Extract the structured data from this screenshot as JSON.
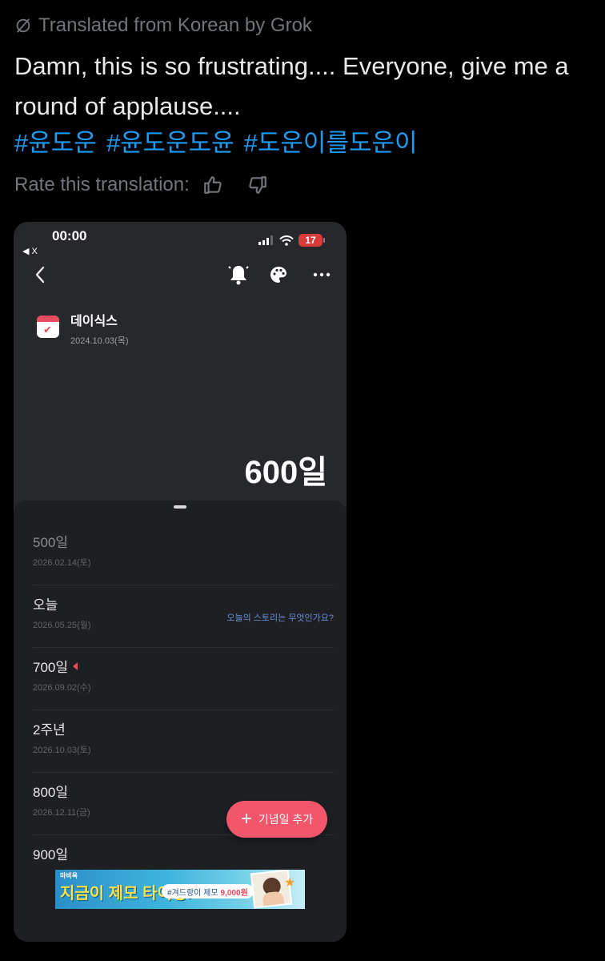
{
  "tweet": {
    "translated_label": "Translated from Korean by Grok",
    "text": "Damn, this is so frustrating.... Everyone, give me a round of applause....",
    "hashtags": [
      "#윤도운",
      "#윤도운도윤",
      "#도운이를도운이"
    ],
    "rate_label": "Rate this translation:",
    "icons": [
      "grok-slash-icon",
      "thumbs-up-icon",
      "thumbs-down-icon"
    ]
  },
  "phone": {
    "status": {
      "time": "00:00",
      "back_app": "◀ X",
      "battery": "17"
    },
    "topbar_icons": [
      "back-chevron-icon",
      "bell-icon",
      "palette-icon",
      "more-icon"
    ],
    "event": {
      "title": "데이식스",
      "date": "2024.10.03(목)"
    },
    "big_days": "600일",
    "list": [
      {
        "label": "500일",
        "date": "2026.02.14(토)",
        "past": true
      },
      {
        "label": "오늘",
        "date": "2026.05.25(월)",
        "story": "오늘의 스토리는 무엇인가요?"
      },
      {
        "label": "700일",
        "date": "2026.09.02(수)",
        "marker": true
      },
      {
        "label": "2주년",
        "date": "2026.10.03(토)"
      },
      {
        "label": "800일",
        "date": "2026.12.11(금)"
      },
      {
        "label": "900일",
        "date": ""
      }
    ],
    "fab": {
      "plus": "+",
      "label": "기념일 추가"
    },
    "ad": {
      "brand": "마비욕",
      "headline": "지금이 제모 타이밍!",
      "pill_text": "#겨드랑이 제모",
      "price": "9,000원"
    },
    "colors": {
      "accent": "#f2566a",
      "link": "#6b8fd6",
      "hashtag": "#1d9bf0"
    }
  }
}
